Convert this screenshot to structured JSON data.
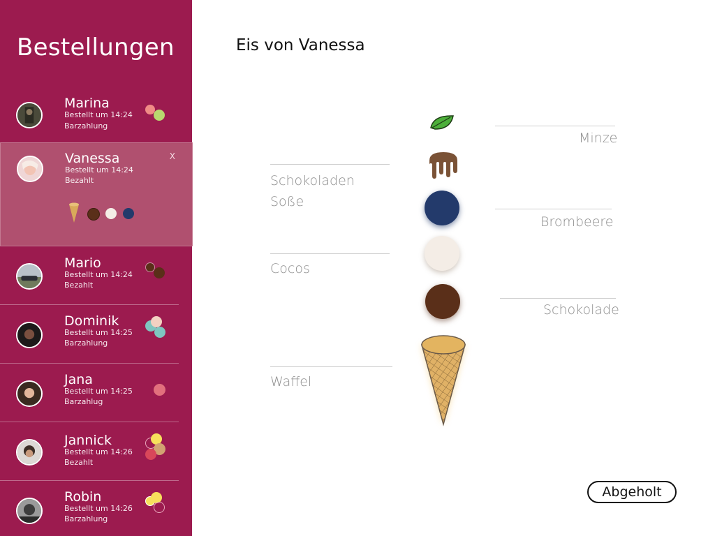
{
  "sidebar": {
    "title": "Bestellungen",
    "orders": [
      {
        "name": "Marina",
        "time": "Bestellt um 14:24",
        "payment": "Barzahlung",
        "flavors": [
          "#f08b86",
          "#b9d86f"
        ]
      },
      {
        "name": "Vanessa",
        "time": "Bestellt um 14:24",
        "payment": "Bezahlt",
        "close": "X",
        "selected": true,
        "details": [
          "waffle-cone",
          "#5a2f19",
          "#f4ede6",
          "#233a6b"
        ]
      },
      {
        "name": "Mario",
        "time": "Bestellt um 14:24",
        "payment": "Bezahlt",
        "flavors": [
          "#5a2f19",
          "#5a2f19"
        ]
      },
      {
        "name": "Dominik",
        "time": "Bestellt um 14:25",
        "payment": "Barzahlung",
        "flavors": [
          "#f3d1c2",
          "#7fc6c0",
          "#7fc6c0"
        ]
      },
      {
        "name": "Jana",
        "time": "Bestellt um 14:25",
        "payment": "Barzahlug",
        "flavors": [
          "#e2707d"
        ]
      },
      {
        "name": "Jannick",
        "time": "Bestellt um 14:26",
        "payment": "Bezahlt",
        "flavors": [
          "#f7e05c",
          "#d2a272",
          "#d9475a"
        ]
      },
      {
        "name": "Robin",
        "time": "Bestellt um 14:26",
        "payment": "Barzahlung",
        "flavors": [
          "#f7e05c",
          "#f7e05c",
          "#9c1b4f"
        ]
      }
    ]
  },
  "main": {
    "title": "Eis von Vanessa",
    "labels": {
      "minze": "Minze",
      "sauce_line1": "Schokoladen",
      "sauce_line2": "Soße",
      "brombeere": "Brombeere",
      "cocos": "Cocos",
      "schokolade": "Schokolade",
      "waffel": "Waffel"
    },
    "button": "Abgeholt"
  },
  "colors": {
    "sidebar": "#9c1b4f",
    "selected": "#b0506f",
    "mint_leaf": "#4caf3a",
    "chocolate_sauce": "#7a5236",
    "blackberry": "#233a6b",
    "coconut": "#f4ede6",
    "chocolate": "#5a2f19",
    "waffle": "#e0b166"
  },
  "icons": [
    "mint-leaf-icon",
    "chocolate-sauce-icon",
    "waffle-cone-icon"
  ]
}
